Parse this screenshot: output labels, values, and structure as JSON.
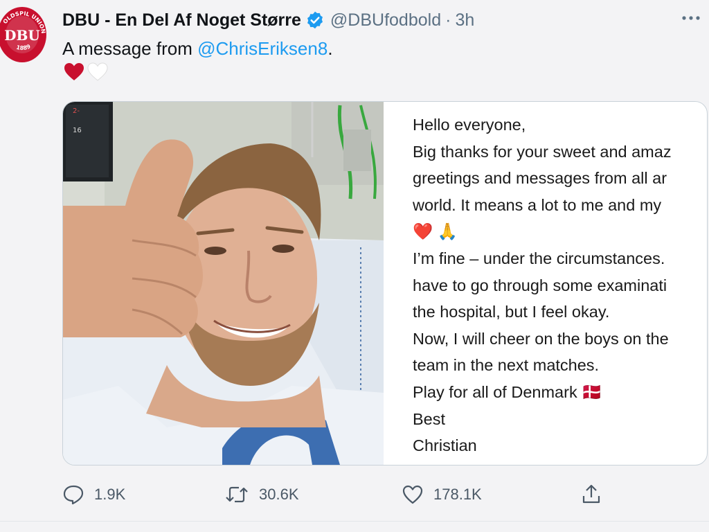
{
  "tweet": {
    "display_name": "DBU - En Del Af Noget Større",
    "handle": "@DBUfodbold",
    "separator": "·",
    "time": "3h",
    "text_prefix": "A message from ",
    "mention": "@ChrisEriksen8",
    "text_suffix": ".",
    "avatar": {
      "top_text": "OLDSPIL",
      "right_text": "UNION",
      "center_text": "DBU",
      "bottom_text": "1889",
      "color": "#c8102e"
    },
    "hearts": [
      "red-heart-icon",
      "white-heart-icon"
    ],
    "colors": {
      "link": "#1d9bf0",
      "secondary": "#5b7083",
      "heart_red": "#c8102e"
    }
  },
  "letter": {
    "lines": [
      "Hello everyone,",
      "Big thanks for your sweet and amaz",
      "greetings and messages from all ar",
      "world. It means a lot to me and my",
      "❤️ 🙏",
      "I’m fine – under the circumstances.",
      "have to go through some examinati",
      "the hospital, but I feel okay.",
      "Now, I will cheer on the boys on the",
      "team in the next matches.",
      "Play for all of Denmark 🇩🇰",
      "Best",
      "Christian"
    ]
  },
  "photo": {
    "monitor_text_top": "2-",
    "monitor_text_num": "16"
  },
  "actions": {
    "reply_count": "1.9K",
    "retweet_count": "30.6K",
    "like_count": "178.1K"
  }
}
